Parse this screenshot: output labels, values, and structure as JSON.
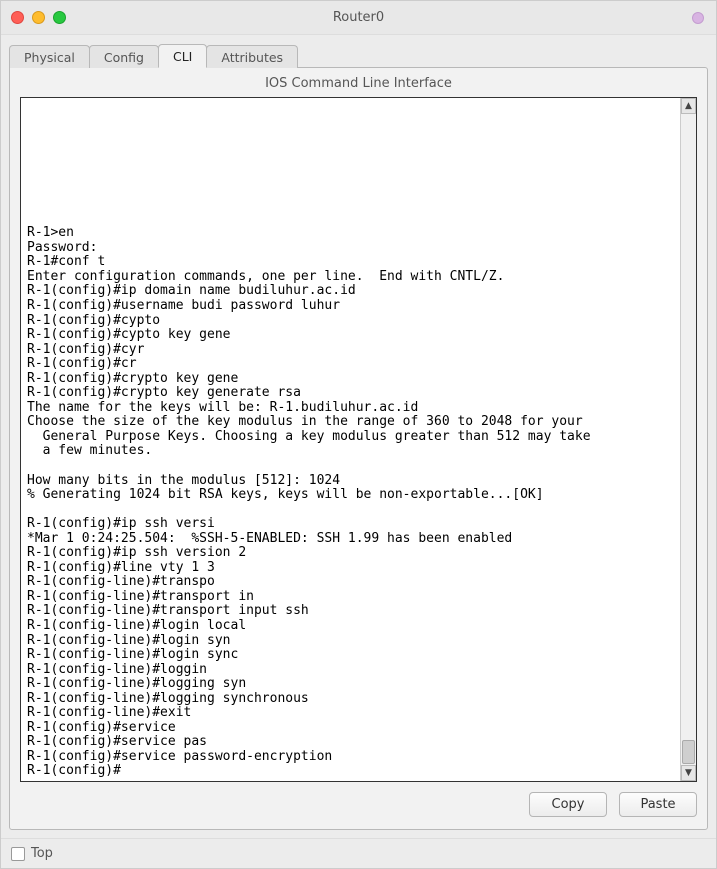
{
  "window": {
    "title": "Router0"
  },
  "tabs": [
    {
      "label": "Physical"
    },
    {
      "label": "Config"
    },
    {
      "label": "CLI"
    },
    {
      "label": "Attributes"
    }
  ],
  "active_tab_index": 2,
  "panel": {
    "title": "IOS Command Line Interface"
  },
  "terminal_text": "R-1>en\nPassword:\nR-1#conf t\nEnter configuration commands, one per line.  End with CNTL/Z.\nR-1(config)#ip domain name budiluhur.ac.id\nR-1(config)#username budi password luhur\nR-1(config)#cypto\nR-1(config)#cypto key gene\nR-1(config)#cyr\nR-1(config)#cr\nR-1(config)#crypto key gene\nR-1(config)#crypto key generate rsa\nThe name for the keys will be: R-1.budiluhur.ac.id\nChoose the size of the key modulus in the range of 360 to 2048 for your\n  General Purpose Keys. Choosing a key modulus greater than 512 may take\n  a few minutes.\n\nHow many bits in the modulus [512]: 1024\n% Generating 1024 bit RSA keys, keys will be non-exportable...[OK]\n\nR-1(config)#ip ssh versi\n*Mar 1 0:24:25.504:  %SSH-5-ENABLED: SSH 1.99 has been enabled\nR-1(config)#ip ssh version 2\nR-1(config)#line vty 1 3\nR-1(config-line)#transpo\nR-1(config-line)#transport in\nR-1(config-line)#transport input ssh\nR-1(config-line)#login local\nR-1(config-line)#login syn\nR-1(config-line)#login sync\nR-1(config-line)#loggin\nR-1(config-line)#logging syn\nR-1(config-line)#logging synchronous\nR-1(config-line)#exit\nR-1(config)#service\nR-1(config)#service pas\nR-1(config)#service password-encryption\nR-1(config)#",
  "buttons": {
    "copy": "Copy",
    "paste": "Paste"
  },
  "footer": {
    "top_label": "Top",
    "top_checked": false
  }
}
